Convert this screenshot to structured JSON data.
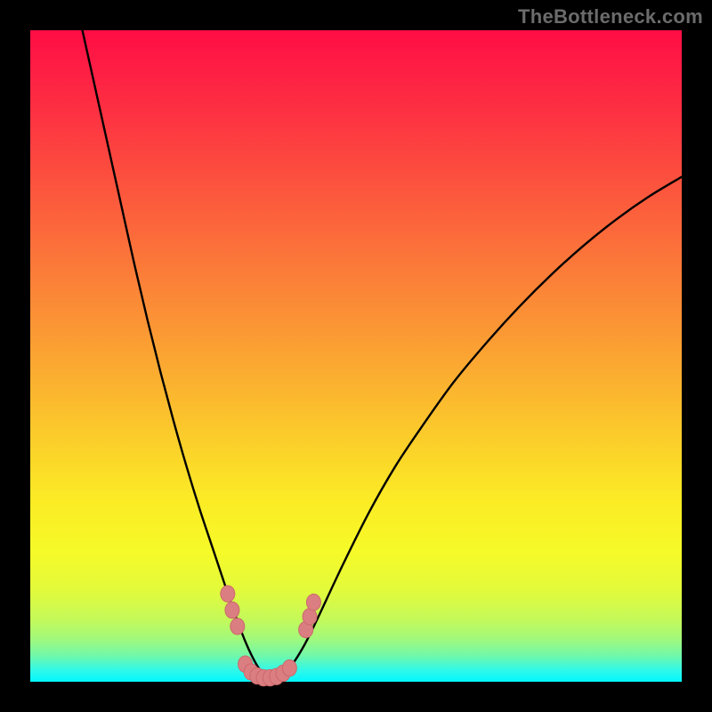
{
  "watermark": "TheBottleneck.com",
  "layout": {
    "outer_size": 800,
    "frame_border": 34,
    "plot_size": 732
  },
  "colors": {
    "frame": "#000000",
    "curve_stroke": "#000000",
    "beads_fill": "#db7e81",
    "beads_stroke": "#cc686c",
    "watermark": "#6b6b6b"
  },
  "gradient_stops": [
    {
      "offset": 0.0,
      "color": "#fe0d45"
    },
    {
      "offset": 0.12,
      "color": "#fd2f42"
    },
    {
      "offset": 0.25,
      "color": "#fc573d"
    },
    {
      "offset": 0.38,
      "color": "#fb7f38"
    },
    {
      "offset": 0.5,
      "color": "#fba432"
    },
    {
      "offset": 0.62,
      "color": "#fbcb2b"
    },
    {
      "offset": 0.72,
      "color": "#fbeb25"
    },
    {
      "offset": 0.8,
      "color": "#f6fa28"
    },
    {
      "offset": 0.86,
      "color": "#e2fa3c"
    },
    {
      "offset": 0.905,
      "color": "#c4f95a"
    },
    {
      "offset": 0.935,
      "color": "#a0f97d"
    },
    {
      "offset": 0.96,
      "color": "#71f8aa"
    },
    {
      "offset": 0.982,
      "color": "#31f8e8"
    },
    {
      "offset": 1.0,
      "color": "#02f8ff"
    }
  ],
  "chart_data": {
    "type": "line",
    "title": "",
    "xlabel": "",
    "ylabel": "",
    "xlim": [
      0,
      100
    ],
    "ylim": [
      0,
      100
    ],
    "grid": false,
    "legend": false,
    "annotations": [
      {
        "text": "TheBottleneck.com",
        "position": "top-right"
      }
    ],
    "series": [
      {
        "name": "curve",
        "x": [
          8.0,
          10.0,
          12.0,
          14.0,
          16.0,
          18.0,
          20.0,
          22.0,
          24.0,
          26.0,
          28.0,
          30.0,
          31.0,
          32.0,
          33.0,
          34.0,
          35.0,
          36.0,
          37.0,
          38.0,
          40.0,
          42.0,
          44.0,
          48.0,
          52.0,
          56.0,
          60.0,
          65.0,
          70.0,
          75.0,
          80.0,
          85.0,
          90.0,
          95.0,
          100.0
        ],
        "y": [
          100.0,
          91.0,
          82.0,
          73.0,
          64.0,
          55.5,
          47.5,
          40.0,
          33.0,
          26.5,
          20.5,
          14.5,
          11.5,
          8.8,
          6.2,
          4.0,
          2.2,
          1.1,
          0.5,
          0.8,
          2.4,
          5.5,
          9.5,
          18.0,
          26.0,
          33.0,
          39.0,
          46.0,
          52.0,
          57.5,
          62.5,
          67.0,
          71.0,
          74.5,
          77.5
        ]
      }
    ],
    "beads": [
      {
        "x": 30.3,
        "y": 13.5
      },
      {
        "x": 31.0,
        "y": 11.0
      },
      {
        "x": 31.8,
        "y": 8.5
      },
      {
        "x": 33.0,
        "y": 2.7
      },
      {
        "x": 33.9,
        "y": 1.5
      },
      {
        "x": 34.8,
        "y": 0.9
      },
      {
        "x": 35.8,
        "y": 0.6
      },
      {
        "x": 36.8,
        "y": 0.6
      },
      {
        "x": 37.8,
        "y": 0.8
      },
      {
        "x": 38.8,
        "y": 1.3
      },
      {
        "x": 39.8,
        "y": 2.1
      },
      {
        "x": 42.3,
        "y": 8.0
      },
      {
        "x": 42.9,
        "y": 10.0
      },
      {
        "x": 43.5,
        "y": 12.2
      }
    ],
    "bead_radius_px": 8
  }
}
